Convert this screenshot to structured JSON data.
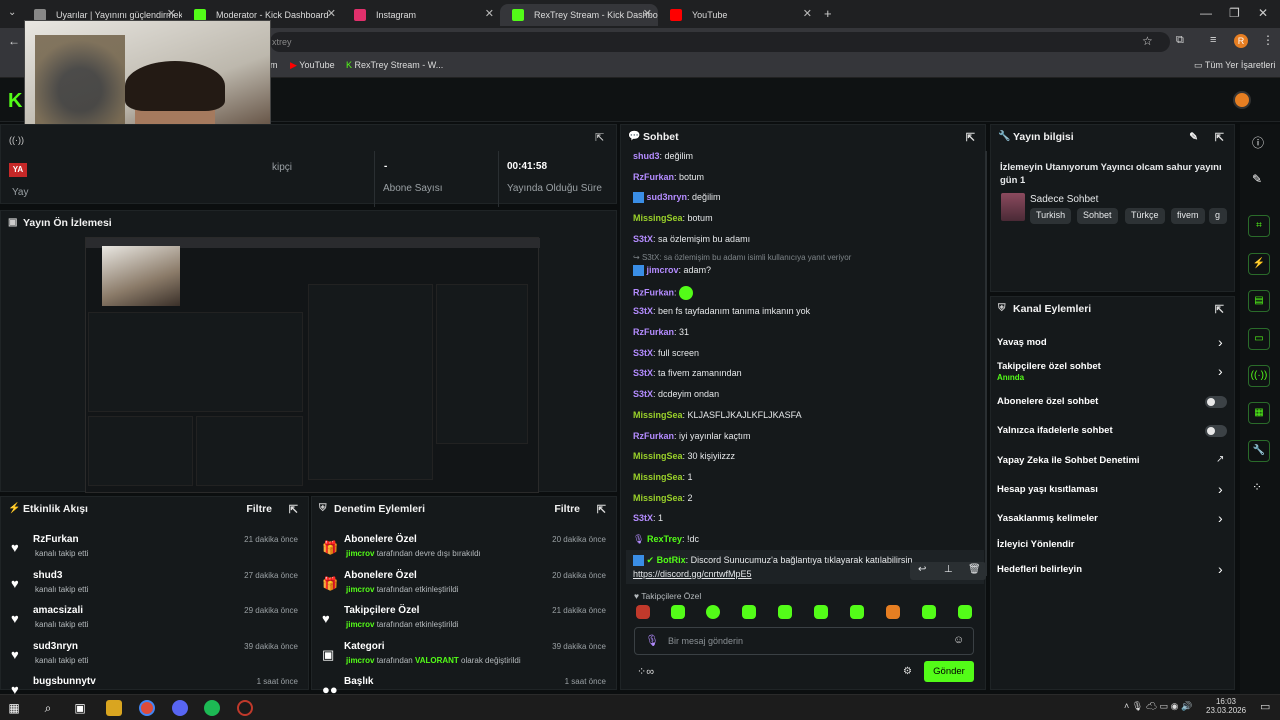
{
  "browser": {
    "tabs": [
      {
        "label": "Uyarılar | Yayınını güçlendirmek"
      },
      {
        "label": "Moderator - Kick Dashboard"
      },
      {
        "label": "Instagram"
      },
      {
        "label": "RexTrey Stream - Kick Dashboa"
      },
      {
        "label": "YouTube"
      }
    ],
    "url_fragment": "xtrey",
    "bookmarks": [
      {
        "label": "m"
      },
      {
        "label": "YouTube"
      },
      {
        "label": "RexTrey Stream - W..."
      }
    ],
    "all_bookmarks": "Tüm Yer İşaretleri"
  },
  "stats": {
    "followers_label": "kipçi",
    "subs_value": "-",
    "subs_label": "Abone Sayısı",
    "time_value": "00:41:58",
    "time_label": "Yayında Olduğu Süre"
  },
  "preview": {
    "title": "Yayın Ön İzlemesi"
  },
  "activity": {
    "title": "Etkinlik Akışı",
    "filter": "Filtre",
    "items": [
      {
        "name": "RzFurkan",
        "sub": "kanalı takip etti",
        "time": "21 dakika önce"
      },
      {
        "name": "shud3",
        "sub": "kanalı takip etti",
        "time": "27 dakika önce"
      },
      {
        "name": "amacsizali",
        "sub": "kanalı takip etti",
        "time": "29 dakika önce"
      },
      {
        "name": "sud3nryn",
        "sub": "kanalı takip etti",
        "time": "39 dakika önce"
      },
      {
        "name": "bugsbunnytv",
        "sub": "",
        "time": "1 saat önce"
      }
    ]
  },
  "mod": {
    "title": "Denetim Eylemleri",
    "filter": "Filtre",
    "items": [
      {
        "name": "Abonelere Özel",
        "user": "jimcrov",
        "mid": " tarafından devre dışı bırakıldı",
        "hl": "",
        "end": "",
        "time": "20 dakika önce"
      },
      {
        "name": "Abonelere Özel",
        "user": "jimcrov",
        "mid": " tarafından etkinleştirildi",
        "hl": "",
        "end": "",
        "time": "20 dakika önce"
      },
      {
        "name": "Takipçilere Özel",
        "user": "jimcrov",
        "mid": " tarafından etkinleştirildi",
        "hl": "",
        "end": "",
        "time": "21 dakika önce"
      },
      {
        "name": "Kategori",
        "user": "jimcrov",
        "mid": " tarafından ",
        "hl": "VALORANT",
        "end": " olarak değiştirildi",
        "time": "39 dakika önce"
      },
      {
        "name": "Başlık",
        "user": "",
        "mid": "",
        "hl": "",
        "end": "",
        "time": "1 saat önce"
      }
    ]
  },
  "chat": {
    "title": "Sohbet",
    "messages": [
      {
        "user": "shud3",
        "color": "#b48cff",
        "text": "değilim"
      },
      {
        "user": "RzFurkan",
        "color": "#b48cff",
        "text": "botum"
      },
      {
        "user": "sud3nryn",
        "color": "#b48cff",
        "text": "değilim"
      },
      {
        "user": "MissingSea",
        "color": "#9ad12a",
        "text": "botum"
      },
      {
        "user": "S3tX",
        "color": "#b48cff",
        "text": "sa özlemişim bu adamı"
      },
      {
        "user": "jimcrov",
        "color": "#b48cff",
        "text": "adam?"
      },
      {
        "user": "RzFurkan",
        "color": "#b48cff",
        "text": ""
      },
      {
        "user": "S3tX",
        "color": "#b48cff",
        "text": "ben fs tayfadanım tanıma imkanın yok"
      },
      {
        "user": "RzFurkan",
        "color": "#b48cff",
        "text": "31"
      },
      {
        "user": "S3tX",
        "color": "#b48cff",
        "text": "full screen"
      },
      {
        "user": "S3tX",
        "color": "#b48cff",
        "text": "ta fivem zamanından"
      },
      {
        "user": "S3tX",
        "color": "#b48cff",
        "text": "dcdeyim ondan"
      },
      {
        "user": "MissingSea",
        "color": "#9ad12a",
        "text": "KLJASFLJKAJLKFLJKASFA"
      },
      {
        "user": "RzFurkan",
        "color": "#b48cff",
        "text": "iyi yayınlar kaçtım"
      },
      {
        "user": "MissingSea",
        "color": "#9ad12a",
        "text": "30 kişiyiizzz"
      },
      {
        "user": "MissingSea",
        "color": "#9ad12a",
        "text": "1"
      },
      {
        "user": "MissingSea",
        "color": "#9ad12a",
        "text": "2"
      },
      {
        "user": "S3tX",
        "color": "#b48cff",
        "text": "1"
      },
      {
        "user": "RexTrey",
        "color": "#53fc18",
        "text": "!dc"
      }
    ],
    "reply_hint": "S3tX: sa özlemişim bu adamı isimli kullanıcıya yanıt veriyor",
    "bot_user": "BotRix",
    "bot_text": "Discord Sunucumuz'a bağlantıya tıklayarak katılabilirsin",
    "bot_link": "https://discord.gg/cnrtwfMpE5",
    "followers_only": "Takipçilere Özel",
    "input_placeholder": "Bir mesaj gönderin",
    "send": "Gönder",
    "infinity": "∞"
  },
  "info": {
    "title": "Yayın bilgisi",
    "stream_title": "İzlemeyin Utanıyorum Yayıncı olcam sahur yayını gün 1",
    "category": "Sadece Sohbet",
    "tags": [
      "Turkish",
      "Sohbet",
      "Türkçe",
      "fivem",
      "g"
    ]
  },
  "channel": {
    "title": "Kanal Eylemleri",
    "slow": "Yavaş mod",
    "followers": "Takipçilere özel sohbet",
    "followers_state": "Anında",
    "subs": "Abonelere özel sohbet",
    "emotes": "Yalnızca ifadelerle sohbet",
    "ai": "Yapay Zeka ile Sohbet Denetimi",
    "age": "Hesap yaşı kısıtlaması",
    "banned": "Yasaklanmış kelimeler",
    "redirect": "İzleyici Yönlendir",
    "goals": "Hedefleri belirleyin"
  },
  "taskbar": {
    "time": "16:03",
    "date": "23.03.2026"
  },
  "colors": {
    "accent": "#53fc18",
    "panel": "#15191b",
    "bg": "#0b0e0f"
  }
}
